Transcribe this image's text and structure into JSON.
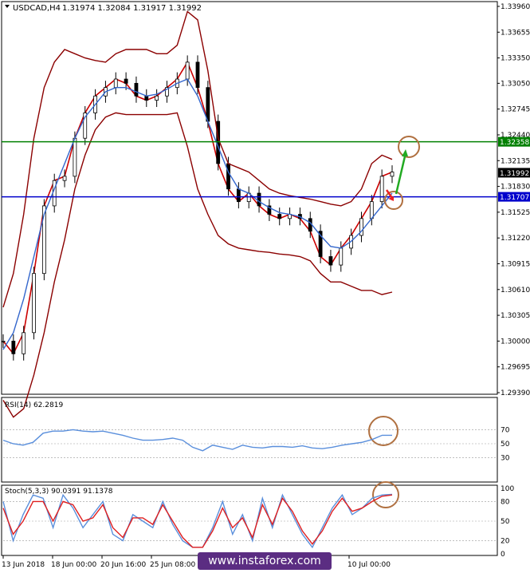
{
  "window": {
    "symbol_title": "USDCAD,H4",
    "ohlc": "1.31974 1.32084 1.31917 1.31992"
  },
  "rsi": {
    "label": "RSI(14) 62.2819",
    "levels": [
      "70",
      "50",
      "30"
    ]
  },
  "stoch": {
    "label": "Stoch(5,3,3) 90.0391 91.1378",
    "levels": [
      "100",
      "80",
      "50",
      "20",
      "0"
    ]
  },
  "watermark": "www.instaforex.com",
  "colors": {
    "price_line": "#cc0000",
    "ma_blue": "#3366cc",
    "bollinger": "#8b0000",
    "green_level": "#008000",
    "blue_level": "#0000cc",
    "annotation_circle": "#b07040",
    "arrow_green": "#22aa22",
    "arrow_red": "#ee2222",
    "osc_blue": "#5a8fdc",
    "stoch_red": "#e02020"
  },
  "chart_data": {
    "type": "line",
    "title": "USDCAD,H4",
    "y_axis_labels": [
      "1.33960",
      "1.33655",
      "1.33350",
      "1.33050",
      "1.32745",
      "1.32440",
      "1.32135",
      "1.31830",
      "1.31525",
      "1.31220",
      "1.30915",
      "1.30610",
      "1.30305",
      "1.30000",
      "1.29695",
      "1.29390"
    ],
    "ylim": [
      1.2939,
      1.3396
    ],
    "x_axis_labels": [
      "13 Jun 2018",
      "18 Jun 00:00",
      "20 Jun 16:00",
      "25 Jun 08:00",
      "",
      "",
      "",
      "",
      "10 Jul 00:00"
    ],
    "levels": [
      {
        "value": 1.32358,
        "label": "1.32358",
        "color": "green"
      },
      {
        "value": 1.31707,
        "label": "1.31707",
        "color": "blue"
      },
      {
        "value": 1.31992,
        "label": "1.31992",
        "color": "black"
      }
    ],
    "series": [
      {
        "values": [
          1.3,
          1.2985,
          1.301,
          1.308,
          1.316,
          1.319,
          1.3195,
          1.324,
          1.327,
          1.329,
          1.33,
          1.331,
          1.3305,
          1.329,
          1.3285,
          1.329,
          1.33,
          1.331,
          1.333,
          1.33,
          1.326,
          1.321,
          1.318,
          1.3165,
          1.3175,
          1.316,
          1.315,
          1.3145,
          1.315,
          1.3145,
          1.313,
          1.31,
          1.309,
          1.311,
          1.3125,
          1.3145,
          1.3165,
          1.3195,
          1.32
        ]
      },
      {
        "values": [
          1.299,
          1.301,
          1.305,
          1.31,
          1.315,
          1.318,
          1.321,
          1.324,
          1.3265,
          1.328,
          1.3295,
          1.33,
          1.33,
          1.3295,
          1.329,
          1.3292,
          1.3298,
          1.3305,
          1.331,
          1.329,
          1.326,
          1.323,
          1.32,
          1.318,
          1.3175,
          1.3165,
          1.3158,
          1.3152,
          1.315,
          1.3147,
          1.314,
          1.3125,
          1.3112,
          1.311,
          1.3118,
          1.313,
          1.3145,
          1.316,
          1.3175
        ]
      },
      {
        "values": [
          1.296,
          1.2945,
          1.296,
          1.301,
          1.308,
          1.315,
          1.32,
          1.3225,
          1.324,
          1.325,
          1.3255,
          1.3262,
          1.3265,
          1.3265,
          1.3265,
          1.3268,
          1.327,
          1.3272,
          1.327,
          1.324,
          1.32,
          1.317,
          1.315,
          1.3135,
          1.3125,
          1.3118,
          1.3112,
          1.3108,
          1.3107,
          1.3108,
          1.3105,
          1.3095,
          1.308,
          1.3075,
          1.308,
          1.31,
          1.312,
          1.314,
          1.316
        ]
      },
      {
        "values": [
          1.304,
          1.308,
          1.315,
          1.324,
          1.33,
          1.333,
          1.3345,
          1.334,
          1.3335,
          1.3332,
          1.333,
          1.334,
          1.3345,
          1.3345,
          1.3345,
          1.334,
          1.334,
          1.335,
          1.339,
          1.338,
          1.332,
          1.324,
          1.321,
          1.3205,
          1.32,
          1.319,
          1.318,
          1.3175,
          1.3172,
          1.317,
          1.3168,
          1.3165,
          1.3162,
          1.316,
          1.3165,
          1.318,
          1.321,
          1.322,
          1.3215
        ]
      },
      {
        "values": [
          1.293,
          1.291,
          1.292,
          1.296,
          1.301,
          1.307,
          1.312,
          1.318,
          1.322,
          1.325,
          1.3265,
          1.327,
          1.3268,
          1.3268,
          1.3268,
          1.3268,
          1.3268,
          1.327,
          1.323,
          1.318,
          1.315,
          1.3125,
          1.3115,
          1.311,
          1.3108,
          1.3106,
          1.3105,
          1.3103,
          1.3102,
          1.31,
          1.3095,
          1.308,
          1.307,
          1.307,
          1.3065,
          1.306,
          1.306,
          1.3055,
          1.3058
        ]
      }
    ],
    "rsi_values": [
      55,
      50,
      48,
      52,
      65,
      68,
      68,
      70,
      68,
      67,
      68,
      65,
      62,
      58,
      55,
      55,
      56,
      58,
      55,
      45,
      40,
      48,
      45,
      42,
      48,
      45,
      44,
      46,
      46,
      45,
      47,
      44,
      43,
      45,
      48,
      50,
      52,
      56,
      62,
      62
    ],
    "stoch_k": [
      80,
      20,
      60,
      90,
      85,
      40,
      90,
      70,
      40,
      60,
      80,
      30,
      20,
      60,
      50,
      40,
      80,
      45,
      20,
      10,
      10,
      40,
      80,
      30,
      60,
      20,
      85,
      40,
      90,
      60,
      30,
      10,
      40,
      70,
      90,
      60,
      70,
      85,
      90,
      91
    ],
    "stoch_d": [
      70,
      30,
      50,
      80,
      80,
      50,
      80,
      75,
      50,
      55,
      75,
      40,
      25,
      55,
      55,
      45,
      75,
      50,
      25,
      10,
      10,
      35,
      70,
      40,
      55,
      25,
      75,
      45,
      85,
      65,
      35,
      15,
      35,
      65,
      85,
      65,
      70,
      80,
      88,
      90
    ]
  }
}
